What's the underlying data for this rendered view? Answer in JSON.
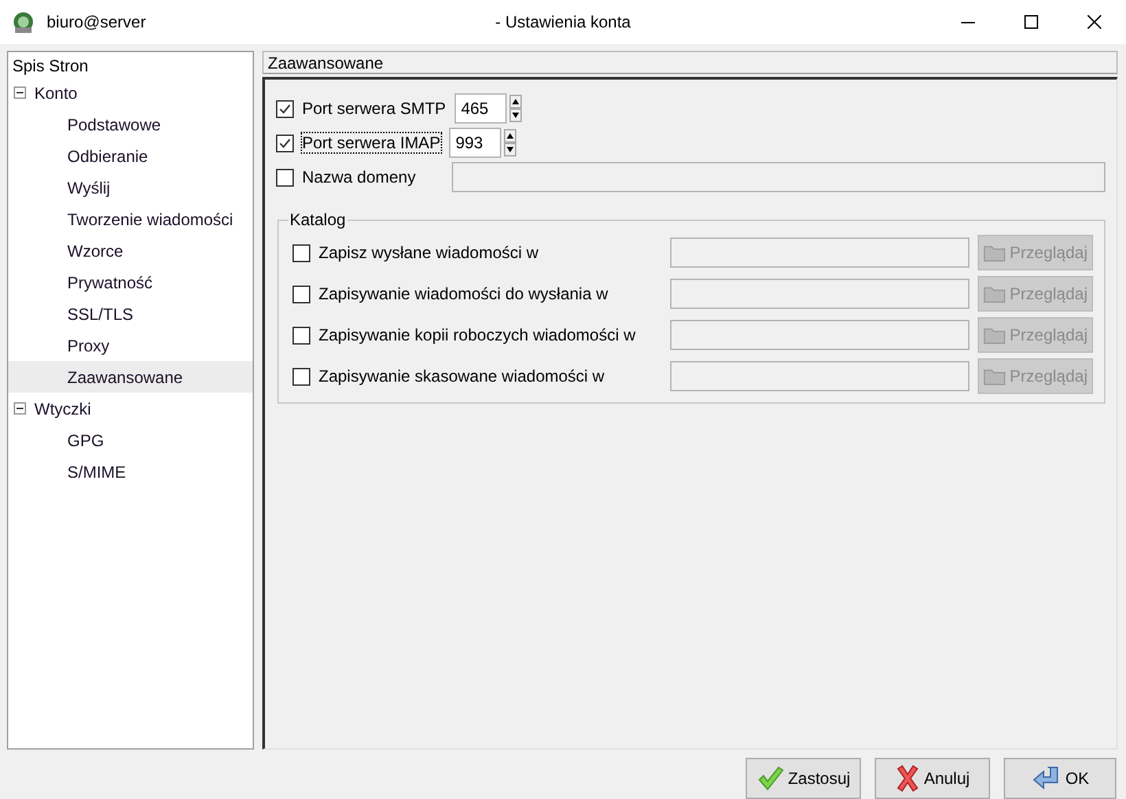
{
  "window": {
    "title": "- Ustawienia konta",
    "account": "biuro@server"
  },
  "sidebar": {
    "header": "Spis Stron",
    "items": [
      {
        "label": "Konto",
        "expanded": true,
        "selected": false,
        "children": [
          {
            "label": "Podstawowe",
            "selected": false
          },
          {
            "label": "Odbieranie",
            "selected": false
          },
          {
            "label": "Wyślij",
            "selected": false
          },
          {
            "label": "Tworzenie wiadomości",
            "selected": false
          },
          {
            "label": "Wzorce",
            "selected": false
          },
          {
            "label": "Prywatność",
            "selected": false
          },
          {
            "label": "SSL/TLS",
            "selected": false
          },
          {
            "label": "Proxy",
            "selected": false
          },
          {
            "label": "Zaawansowane",
            "selected": true
          }
        ]
      },
      {
        "label": "Wtyczki",
        "expanded": true,
        "selected": false,
        "children": [
          {
            "label": "GPG",
            "selected": false
          },
          {
            "label": "S/MIME",
            "selected": false
          }
        ]
      }
    ]
  },
  "page": {
    "title": "Zaawansowane",
    "settings": [
      {
        "kind": "spin",
        "label": "Port serwera SMTP",
        "checked": true,
        "focused": false,
        "value": "465"
      },
      {
        "kind": "spin",
        "label": "Port serwera IMAP",
        "checked": true,
        "focused": true,
        "value": "993"
      },
      {
        "kind": "text",
        "label": "Nazwa domeny",
        "checked": false,
        "focused": false
      }
    ],
    "catalog": {
      "title": "Katalog",
      "rows": [
        {
          "label": "Zapisz wysłane wiadomości w",
          "checked": false,
          "button": "Przeglądaj",
          "disabled": true
        },
        {
          "label": "Zapisywanie wiadomości do wysłania w",
          "checked": false,
          "button": "Przeglądaj",
          "disabled": true
        },
        {
          "label": "Zapisywanie kopii roboczych wiadomości w",
          "checked": false,
          "button": "Przeglądaj",
          "disabled": true
        },
        {
          "label": "Zapisywanie skasowane wiadomości w",
          "checked": false,
          "button": "Przeglądaj",
          "disabled": true
        }
      ]
    }
  },
  "buttons": [
    {
      "kind": "apply",
      "label": "Zastosuj"
    },
    {
      "kind": "cancel",
      "label": "Anuluj"
    },
    {
      "kind": "ok",
      "label": "OK"
    }
  ]
}
